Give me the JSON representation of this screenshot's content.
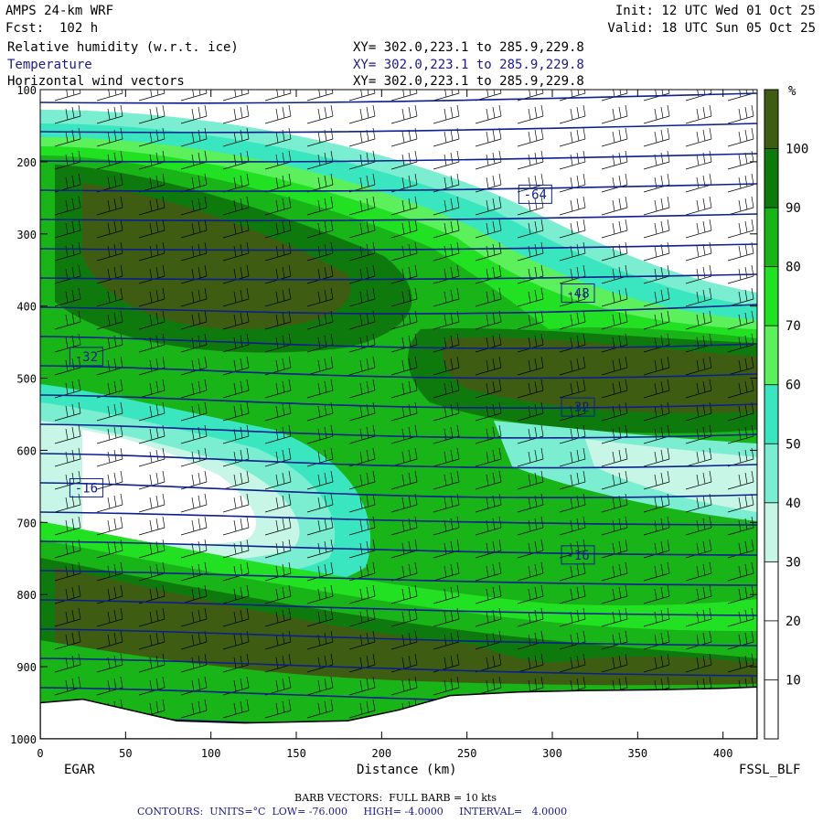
{
  "header": {
    "model": "AMPS 24-km WRF",
    "forecast": "Fcst:  102 h",
    "init": "Init: 12 UTC Wed 01 Oct 25",
    "valid": "Valid: 18 UTC Sun 05 Oct 25",
    "fields": [
      {
        "name": "Relative humidity (w.r.t. ice)",
        "range": "XY= 302.0,223.1 to 285.9,229.8"
      },
      {
        "name": "Temperature",
        "range": "XY= 302.0,223.1 to 285.9,229.8"
      },
      {
        "name": "Horizontal wind vectors",
        "range": "XY= 302.0,223.1 to 285.9,229.8"
      }
    ]
  },
  "chart_data": {
    "type": "heatmap",
    "xlabel": "Distance (km)",
    "xlim": [
      0,
      420
    ],
    "x_ticks": [
      "0",
      "50",
      "100",
      "150",
      "200",
      "250",
      "300",
      "350",
      "400"
    ],
    "ylim": [
      1000,
      100
    ],
    "y_ticks": [
      "100",
      "200",
      "300",
      "400",
      "500",
      "600",
      "700",
      "800",
      "900",
      "1000"
    ],
    "start_label": "EGAR",
    "end_label": "FSSL_BLF",
    "colorbar": {
      "units": "%",
      "tick_labels": [
        "10",
        "20",
        "30",
        "40",
        "50",
        "60",
        "70",
        "80",
        "90",
        "100"
      ],
      "bins": [
        {
          "from": 0,
          "to": 10,
          "color": "#ffffff"
        },
        {
          "from": 10,
          "to": 20,
          "color": "#ffffff"
        },
        {
          "from": 20,
          "to": 30,
          "color": "#ffffff"
        },
        {
          "from": 30,
          "to": 40,
          "color": "#c8f6e6"
        },
        {
          "from": 40,
          "to": 50,
          "color": "#7beed2"
        },
        {
          "from": 50,
          "to": 60,
          "color": "#3ae6c0"
        },
        {
          "from": 60,
          "to": 70,
          "color": "#5cf05c"
        },
        {
          "from": 70,
          "to": 80,
          "color": "#22e022"
        },
        {
          "from": 80,
          "to": 90,
          "color": "#18b418"
        },
        {
          "from": 90,
          "to": 100,
          "color": "#0e7a0e"
        },
        {
          "from": 100,
          "to": 110,
          "color": "#3f5d12"
        }
      ]
    },
    "temperature_contours": {
      "labels": [
        {
          "text": "-64",
          "x": 290,
          "p": 245
        },
        {
          "text": "-48",
          "x": 315,
          "p": 382
        },
        {
          "text": "-32",
          "x": 27,
          "p": 470
        },
        {
          "text": "-32",
          "x": 315,
          "p": 540
        },
        {
          "text": "-16",
          "x": 27,
          "p": 652
        },
        {
          "text": "-16",
          "x": 315,
          "p": 745
        }
      ]
    },
    "terrain_p": [
      [
        0,
        950
      ],
      [
        25,
        945
      ],
      [
        80,
        975
      ],
      [
        120,
        978
      ],
      [
        180,
        975
      ],
      [
        210,
        960
      ],
      [
        240,
        940
      ],
      [
        280,
        935
      ],
      [
        320,
        933
      ],
      [
        360,
        932
      ],
      [
        400,
        930
      ],
      [
        420,
        928
      ]
    ]
  },
  "footer": {
    "barb_note": "BARB VECTORS:  FULL BARB = 10 kts",
    "contour_note": "CONTOURS:  UNITS=°C  LOW= -76.000     HIGH= -4.0000     INTERVAL=   4.0000"
  }
}
